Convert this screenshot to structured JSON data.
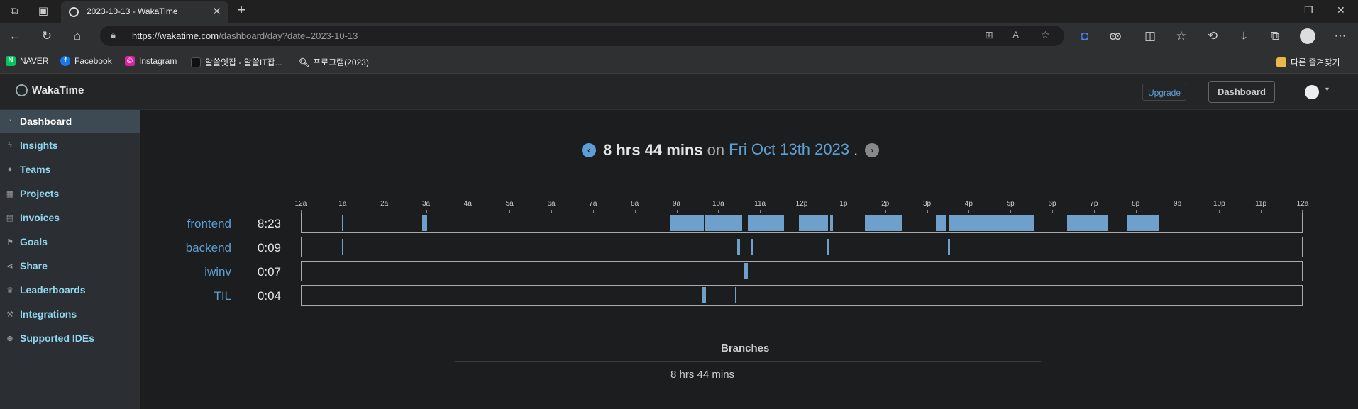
{
  "browser": {
    "tab_title": "2023-10-13 - WakaTime",
    "url_domain": "https://wakatime.com",
    "url_path": "/dashboard/day?date=2023-10-13",
    "bookmarks": [
      "NAVER",
      "Facebook",
      "Instagram",
      "알쓸잇잡 - 알쓸IT잡...",
      "프로그램(2023)"
    ],
    "other_bookmarks": "다른 즐겨찾기"
  },
  "app": {
    "brand": "WakaTime",
    "upgrade_label": "Upgrade",
    "dashboard_label": "Dashboard"
  },
  "sidebar": {
    "items": [
      {
        "label": "Dashboard",
        "icon": "dashboard-icon"
      },
      {
        "label": "Insights",
        "icon": "bolt-icon"
      },
      {
        "label": "Teams",
        "icon": "users-icon"
      },
      {
        "label": "Projects",
        "icon": "grid-icon"
      },
      {
        "label": "Invoices",
        "icon": "file-icon"
      },
      {
        "label": "Goals",
        "icon": "flag-icon"
      },
      {
        "label": "Share",
        "icon": "share-icon"
      },
      {
        "label": "Leaderboards",
        "icon": "trophy-icon"
      },
      {
        "label": "Integrations",
        "icon": "wrench-icon"
      },
      {
        "label": "Supported IDEs",
        "icon": "plus-circle-icon"
      }
    ]
  },
  "summary": {
    "total": "8 hrs 44 mins",
    "on": "on",
    "date": "Fri Oct 13th 2023",
    "period": "."
  },
  "colors": {
    "accent": "#5f9fd2",
    "bar": "#6f9fcb"
  },
  "chart_data": {
    "type": "timeline",
    "x_ticks": [
      "12a",
      "1a",
      "2a",
      "3a",
      "4a",
      "5a",
      "6a",
      "7a",
      "8a",
      "9a",
      "10a",
      "11a",
      "12p",
      "1p",
      "2p",
      "3p",
      "4p",
      "5p",
      "6p",
      "7p",
      "8p",
      "9p",
      "10p",
      "11p",
      "12a"
    ],
    "xlim": [
      0,
      24
    ],
    "projects": [
      {
        "name": "frontend",
        "time": "8:23",
        "segments": [
          [
            0.98,
            1.02
          ],
          [
            2.9,
            3.02
          ],
          [
            8.85,
            9.65
          ],
          [
            9.68,
            10.42
          ],
          [
            10.44,
            10.58
          ],
          [
            10.7,
            11.58
          ],
          [
            11.93,
            12.63
          ],
          [
            12.68,
            12.75
          ],
          [
            13.52,
            14.4
          ],
          [
            15.22,
            15.45
          ],
          [
            15.52,
            17.55
          ],
          [
            18.35,
            19.35
          ],
          [
            19.8,
            20.55
          ]
        ]
      },
      {
        "name": "backend",
        "time": "0:09",
        "segments": [
          [
            0.98,
            1.0
          ],
          [
            10.45,
            10.52
          ],
          [
            10.8,
            10.83
          ],
          [
            12.62,
            12.66
          ],
          [
            15.5,
            15.55
          ]
        ]
      },
      {
        "name": "iwinv",
        "time": "0:07",
        "segments": [
          [
            10.6,
            10.7
          ]
        ]
      },
      {
        "name": "TIL",
        "time": "0:04",
        "segments": [
          [
            9.6,
            9.7
          ],
          [
            10.4,
            10.42
          ]
        ]
      }
    ]
  },
  "branches": {
    "title": "Branches",
    "total": "8 hrs 44 mins"
  }
}
